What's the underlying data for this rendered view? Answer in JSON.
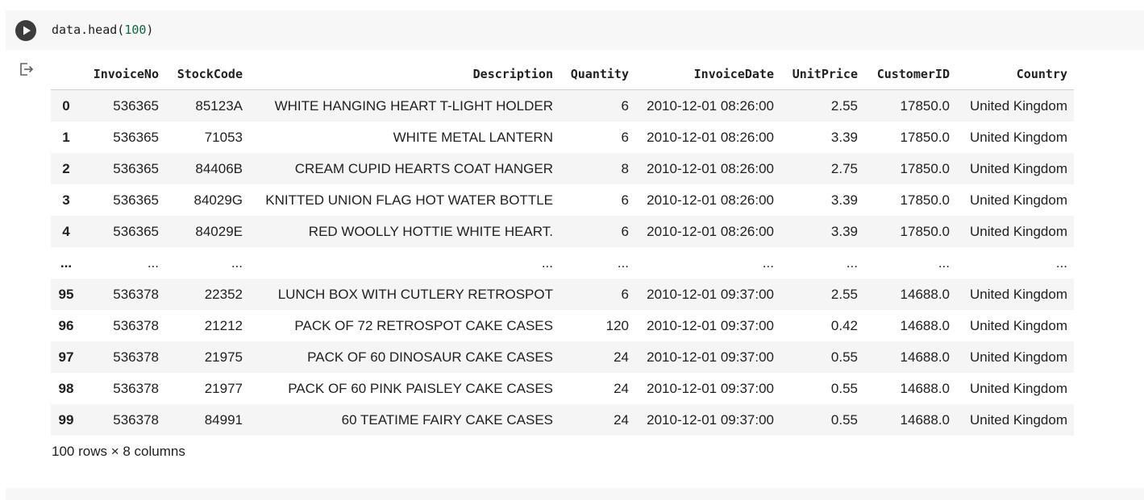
{
  "code_cell": {
    "code_prefix": "data.head(",
    "code_arg": "100",
    "code_suffix": ")"
  },
  "output": {
    "icon": "output-redirect-icon",
    "summary": "100 rows × 8 columns"
  },
  "dataframe": {
    "columns": [
      "InvoiceNo",
      "StockCode",
      "Description",
      "Quantity",
      "InvoiceDate",
      "UnitPrice",
      "CustomerID",
      "Country"
    ],
    "rows": [
      {
        "index": "0",
        "cells": [
          "536365",
          "85123A",
          "WHITE HANGING HEART T-LIGHT HOLDER",
          "6",
          "2010-12-01 08:26:00",
          "2.55",
          "17850.0",
          "United Kingdom"
        ]
      },
      {
        "index": "1",
        "cells": [
          "536365",
          "71053",
          "WHITE METAL LANTERN",
          "6",
          "2010-12-01 08:26:00",
          "3.39",
          "17850.0",
          "United Kingdom"
        ]
      },
      {
        "index": "2",
        "cells": [
          "536365",
          "84406B",
          "CREAM CUPID HEARTS COAT HANGER",
          "8",
          "2010-12-01 08:26:00",
          "2.75",
          "17850.0",
          "United Kingdom"
        ]
      },
      {
        "index": "3",
        "cells": [
          "536365",
          "84029G",
          "KNITTED UNION FLAG HOT WATER BOTTLE",
          "6",
          "2010-12-01 08:26:00",
          "3.39",
          "17850.0",
          "United Kingdom"
        ]
      },
      {
        "index": "4",
        "cells": [
          "536365",
          "84029E",
          "RED WOOLLY HOTTIE WHITE HEART.",
          "6",
          "2010-12-01 08:26:00",
          "3.39",
          "17850.0",
          "United Kingdom"
        ]
      },
      {
        "index": "...",
        "cells": [
          "...",
          "...",
          "...",
          "...",
          "...",
          "...",
          "...",
          "..."
        ]
      },
      {
        "index": "95",
        "cells": [
          "536378",
          "22352",
          "LUNCH BOX WITH CUTLERY RETROSPOT",
          "6",
          "2010-12-01 09:37:00",
          "2.55",
          "14688.0",
          "United Kingdom"
        ]
      },
      {
        "index": "96",
        "cells": [
          "536378",
          "21212",
          "PACK OF 72 RETROSPOT CAKE CASES",
          "120",
          "2010-12-01 09:37:00",
          "0.42",
          "14688.0",
          "United Kingdom"
        ]
      },
      {
        "index": "97",
        "cells": [
          "536378",
          "21975",
          "PACK OF 60 DINOSAUR CAKE CASES",
          "24",
          "2010-12-01 09:37:00",
          "0.55",
          "14688.0",
          "United Kingdom"
        ]
      },
      {
        "index": "98",
        "cells": [
          "536378",
          "21977",
          "PACK OF 60 PINK PAISLEY CAKE CASES",
          "24",
          "2010-12-01 09:37:00",
          "0.55",
          "14688.0",
          "United Kingdom"
        ]
      },
      {
        "index": "99",
        "cells": [
          "536378",
          "84991",
          "60 TEATIME FAIRY CAKE CASES",
          "24",
          "2010-12-01 09:37:00",
          "0.55",
          "14688.0",
          "United Kingdom"
        ]
      }
    ]
  }
}
